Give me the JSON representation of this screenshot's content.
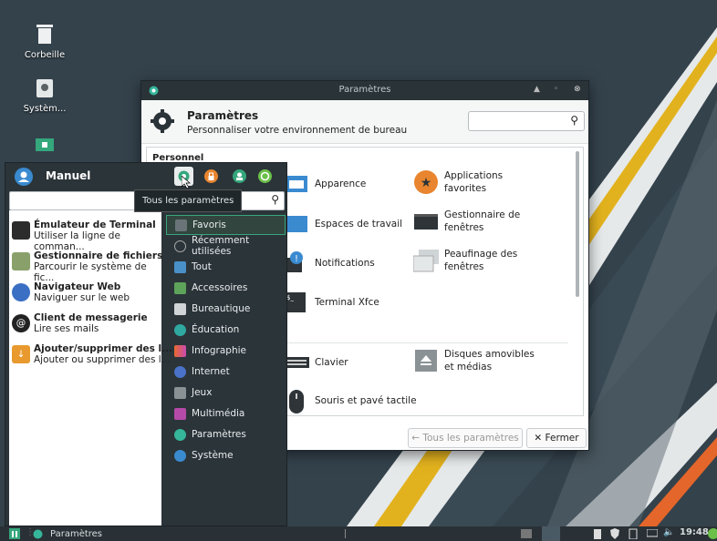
{
  "desktop": {
    "icons": [
      {
        "label": "Corbeille",
        "icon": "trash-icon"
      },
      {
        "label": "Systèm...",
        "icon": "drive-icon"
      },
      {
        "label": "",
        "icon": "home-folder-icon"
      }
    ]
  },
  "settings_window": {
    "title": "Paramètres",
    "header_title": "Paramètres",
    "header_subtitle": "Personnaliser votre environnement de bureau",
    "search_placeholder": "",
    "section_personal": "Personnel",
    "items": [
      {
        "label": "Apparence",
        "icon": "appearance-icon"
      },
      {
        "label": "Applications favorites",
        "icon": "star-icon"
      },
      {
        "label": "Espaces de travail",
        "icon": "workspaces-icon"
      },
      {
        "label": "Gestionnaire de fenêtres",
        "icon": "window-manager-icon"
      },
      {
        "label": "Notifications",
        "icon": "notifications-icon"
      },
      {
        "label": "Peaufinage des fenêtres",
        "icon": "window-tweaks-icon"
      },
      {
        "label": "Terminal Xfce",
        "icon": "terminal-icon"
      },
      {
        "label": "Clavier",
        "icon": "keyboard-icon"
      },
      {
        "label": "Disques amovibles et médias",
        "icon": "removable-drives-icon"
      },
      {
        "label": "Souris et pavé tactile",
        "icon": "mouse-icon"
      }
    ],
    "all_settings_button": "← Tous les paramètres",
    "close_button": "✕ Fermer"
  },
  "menu": {
    "user": "Manuel",
    "search_value": "",
    "tooltip": "Tous les paramètres",
    "apps": [
      {
        "name": "Émulateur de Terminal",
        "desc": "Utiliser la ligne de comman...",
        "color": "#2c2c2c"
      },
      {
        "name": "Gestionnaire de fichiers",
        "desc": "Parcourir le système de fic...",
        "color": "#8aa06a"
      },
      {
        "name": "Navigateur Web",
        "desc": "Naviguer sur le web",
        "color": "#3a6fc4"
      },
      {
        "name": "Client de messagerie",
        "desc": "Lire ses mails",
        "color": "#222222"
      },
      {
        "name": "Ajouter/supprimer des l...",
        "desc": "Ajouter ou supprimer des l...",
        "color": "#e89a2e"
      }
    ],
    "categories": [
      {
        "label": "Favoris",
        "color": "#6a7478"
      },
      {
        "label": "Récemment utilisées",
        "color": "#6a7478"
      },
      {
        "label": "Tout",
        "color": "#4a90c8"
      },
      {
        "label": "Accessoires",
        "color": "#5da35a"
      },
      {
        "label": "Bureautique",
        "color": "#d0d4d6"
      },
      {
        "label": "Éducation",
        "color": "#2fa9a0"
      },
      {
        "label": "Infographie",
        "color": "#e86a2e"
      },
      {
        "label": "Internet",
        "color": "#4a72c8"
      },
      {
        "label": "Jeux",
        "color": "#8a9296"
      },
      {
        "label": "Multimédia",
        "color": "#b54aa8"
      },
      {
        "label": "Paramètres",
        "color": "#35b59a"
      },
      {
        "label": "Système",
        "color": "#3a8ad0"
      }
    ]
  },
  "taskbar": {
    "active_window": "Paramètres",
    "clock": "19:48"
  },
  "colors": {
    "accent": "#35a77c",
    "desktop": "#34424c"
  }
}
